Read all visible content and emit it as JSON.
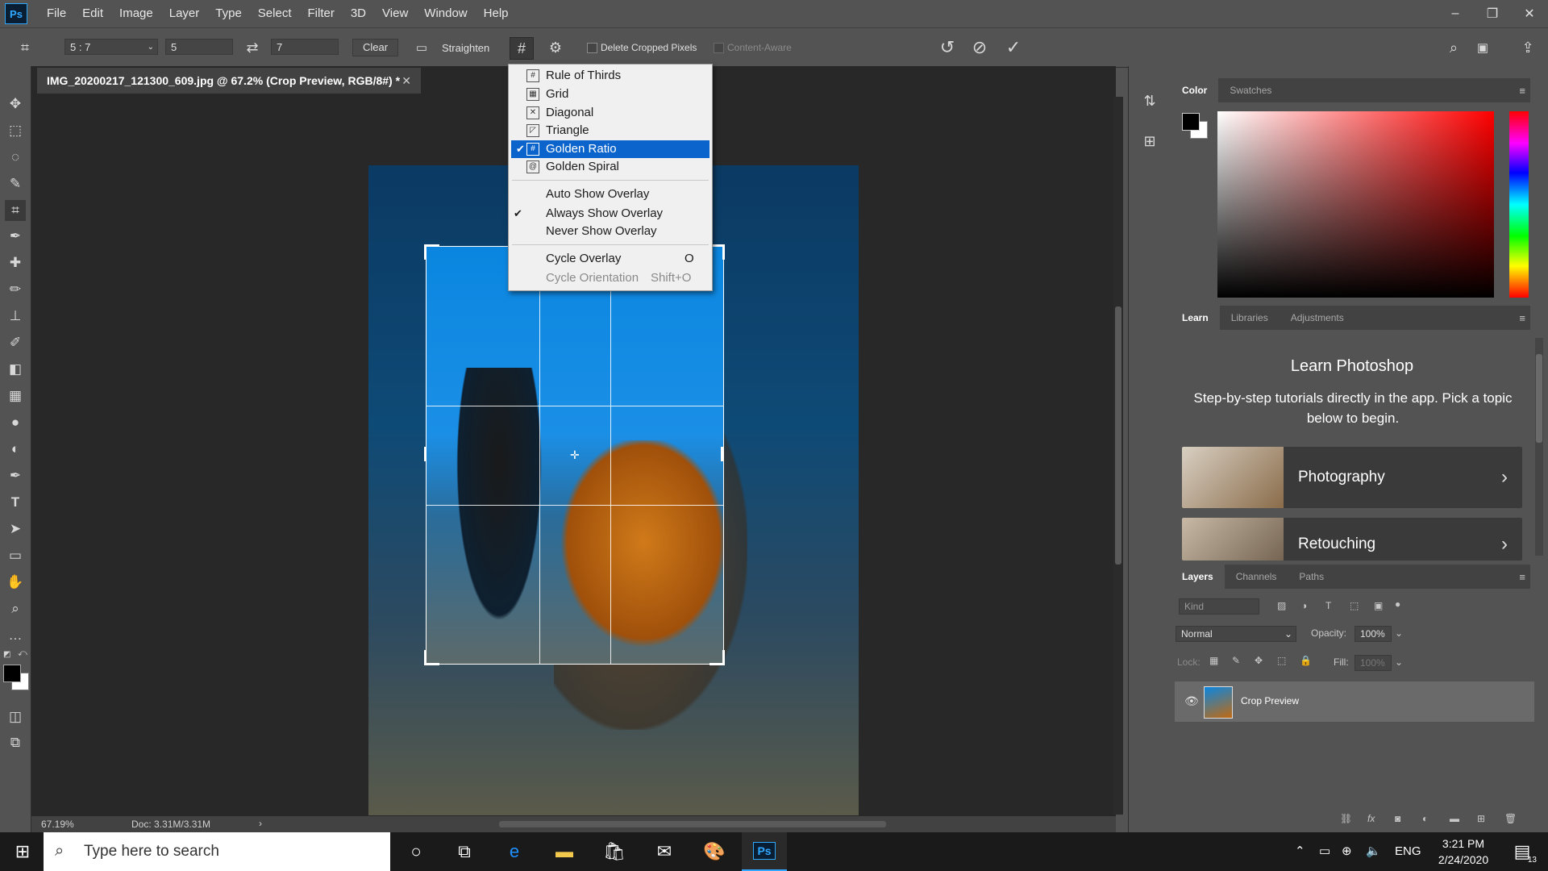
{
  "app": {
    "logo": "Ps"
  },
  "menubar": {
    "items": [
      "File",
      "Edit",
      "Image",
      "Layer",
      "Type",
      "Select",
      "Filter",
      "3D",
      "View",
      "Window",
      "Help"
    ]
  },
  "window_controls": {
    "minimize": "–",
    "restore": "❐",
    "close": "✕"
  },
  "options": {
    "ratio_preset": "5 : 7",
    "width_value": "5",
    "height_value": "7",
    "clear_label": "Clear",
    "straighten_label": "Straighten",
    "delete_cropped_label": "Delete Cropped Pixels",
    "content_aware_label": "Content-Aware"
  },
  "document": {
    "tab_title": "IMG_20200217_121300_609.jpg @ 67.2% (Crop Preview, RGB/8#) *",
    "zoom": "67.19%",
    "doc_size": "Doc: 3.31M/3.31M"
  },
  "overlay_menu": {
    "overlays": [
      {
        "label": "Rule of Thirds",
        "icon": "rule-of-thirds-icon",
        "checked": false
      },
      {
        "label": "Grid",
        "icon": "grid-icon",
        "checked": false
      },
      {
        "label": "Diagonal",
        "icon": "diagonal-icon",
        "checked": false
      },
      {
        "label": "Triangle",
        "icon": "triangle-icon",
        "checked": false
      },
      {
        "label": "Golden Ratio",
        "icon": "golden-ratio-icon",
        "checked": true
      },
      {
        "label": "Golden Spiral",
        "icon": "golden-spiral-icon",
        "checked": false
      }
    ],
    "show_options": [
      {
        "label": "Auto Show Overlay",
        "checked": false
      },
      {
        "label": "Always Show Overlay",
        "checked": true
      },
      {
        "label": "Never Show Overlay",
        "checked": false
      }
    ],
    "cycle_overlay": {
      "label": "Cycle Overlay",
      "shortcut": "O"
    },
    "cycle_orientation": {
      "label": "Cycle Orientation",
      "shortcut": "Shift+O"
    }
  },
  "color_panel": {
    "tabs": [
      "Color",
      "Swatches"
    ],
    "foreground": "#000000",
    "background": "#ffffff"
  },
  "learn_panel": {
    "tabs": [
      "Learn",
      "Libraries",
      "Adjustments"
    ],
    "title": "Learn Photoshop",
    "description": "Step-by-step tutorials directly in the app. Pick a topic below to begin.",
    "topics": [
      "Photography",
      "Retouching"
    ]
  },
  "layers_panel": {
    "tabs": [
      "Layers",
      "Channels",
      "Paths"
    ],
    "kind_placeholder": "Kind",
    "blend_mode": "Normal",
    "opacity_label": "Opacity:",
    "opacity_value": "100%",
    "lock_label": "Lock:",
    "fill_label": "Fill:",
    "fill_value": "100%",
    "layers": [
      {
        "name": "Crop Preview",
        "visible": true
      }
    ]
  },
  "taskbar": {
    "search_placeholder": "Type here to search",
    "language": "ENG",
    "time": "3:21 PM",
    "date": "2/24/2020",
    "notifications": "13"
  },
  "colors": {
    "accent": "#0a64cc",
    "ps_blue": "#31a8ff"
  }
}
